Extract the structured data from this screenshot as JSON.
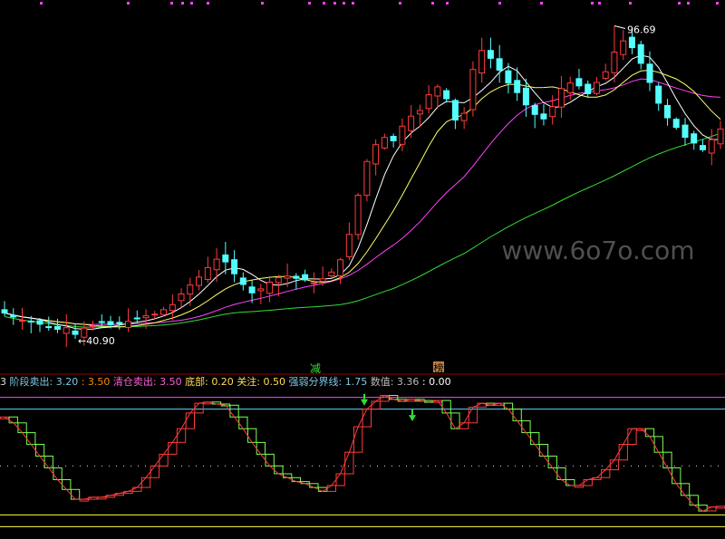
{
  "watermark": "www.6o7o.com",
  "main_panel": {
    "high_label": "96.69",
    "low_label": "40.90",
    "marker_a": "减",
    "marker_b": "榜"
  },
  "indicator_header": {
    "prefix": "3",
    "items": [
      {
        "label": "阶段卖出:",
        "value": "3.20",
        "label_color": "#7ec8e3",
        "value_color": "#7ec8e3"
      },
      {
        "label": ":",
        "value": "3.50",
        "label_color": "#ff8c00",
        "value_color": "#ff8c00"
      },
      {
        "label": "清仓卖出:",
        "value": "3.50",
        "label_color": "#ff5fd7",
        "value_color": "#ff5fd7"
      },
      {
        "label": "底部:",
        "value": "0.20",
        "label_color": "#ffdd55",
        "value_color": "#ffdd55"
      },
      {
        "label": "关注:",
        "value": "0.50",
        "label_color": "#ffdd55",
        "value_color": "#ffdd55"
      },
      {
        "label": "强弱分界线:",
        "value": "1.75",
        "label_color": "#7ec8e3",
        "value_color": "#7ec8e3"
      },
      {
        "label": "数值:",
        "value": "3.36",
        "label_color": "#bbbbbb",
        "value_color": "#bbbbbb"
      },
      {
        "label": ":",
        "value": "0.00",
        "label_color": "#ffffff",
        "value_color": "#ffffff"
      }
    ]
  },
  "colors": {
    "up": "#ff3b3b",
    "down": "#54ffff",
    "ma_fast": "#ffffff",
    "ma_mid": "#ffff66",
    "ma_slow": "#ff44ff",
    "ma_long": "#33dd33",
    "osc_up": "#ff3b3b",
    "osc_down": "#7cff50",
    "line_sell": "#ff44ff",
    "line_clear": "#5fd7ff",
    "line_bottom": "#ffff44",
    "line_mid": "#dddddd"
  },
  "chart_data": [
    {
      "type": "candlestick",
      "title": "",
      "ylim": [
        38,
        100
      ],
      "annotations": [
        {
          "text": "96.69",
          "kind": "high"
        },
        {
          "text": "40.90",
          "kind": "low"
        }
      ],
      "closes": [
        45.5,
        44.8,
        44.2,
        43.9,
        43.5,
        43.0,
        42.6,
        42.9,
        41.7,
        42.8,
        43.2,
        43.9,
        43.4,
        43.6,
        44.0,
        44.5,
        45.0,
        45.3,
        46.1,
        47.0,
        48.9,
        50.5,
        51.9,
        53.6,
        55.1,
        54.6,
        52.5,
        50.6,
        49.1,
        49.8,
        51.0,
        51.8,
        52.1,
        51.7,
        51.4,
        50.9,
        51.6,
        52.8,
        55.0,
        59.5,
        66.5,
        72.5,
        75.5,
        76.8,
        76.2,
        78.8,
        80.6,
        81.6,
        84.4,
        85.8,
        83.7,
        79.9,
        81.1,
        88.9,
        92.3,
        90.9,
        88.8,
        86.5,
        84.8,
        82.6,
        80.9,
        80.1,
        82.3,
        85.5,
        86.5,
        86.0,
        84.6,
        86.6,
        88.5,
        92.0,
        94.0,
        92.8,
        90.0,
        86.6,
        82.9,
        80.3,
        78.6,
        76.8,
        75.8,
        74.6,
        76.4,
        78.3
      ],
      "osc_values": [
        3.0,
        2.85,
        2.6,
        2.3,
        2.0,
        1.7,
        1.4,
        1.15,
        0.9,
        0.9,
        0.95,
        0.95,
        1.0,
        1.05,
        1.1,
        1.2,
        1.45,
        1.75,
        2.05,
        2.35,
        2.7,
        3.1,
        3.35,
        3.38,
        3.33,
        3.3,
        3.0,
        2.7,
        2.35,
        2.05,
        1.75,
        1.55,
        1.45,
        1.35,
        1.3,
        1.2,
        1.1,
        1.25,
        1.55,
        2.1,
        2.75,
        3.2,
        3.4,
        3.55,
        3.45,
        3.4,
        3.45,
        3.42,
        3.38,
        3.42,
        3.1,
        2.7,
        2.85,
        3.25,
        3.35,
        3.3,
        3.35,
        3.2,
        2.9,
        2.6,
        2.3,
        2.0,
        1.7,
        1.4,
        1.25,
        1.25,
        1.4,
        1.45,
        1.65,
        1.9,
        2.3,
        2.7,
        2.7,
        2.5,
        2.1,
        1.7,
        1.3,
        1.0,
        0.75,
        0.6,
        0.7,
        0.72
      ]
    }
  ]
}
